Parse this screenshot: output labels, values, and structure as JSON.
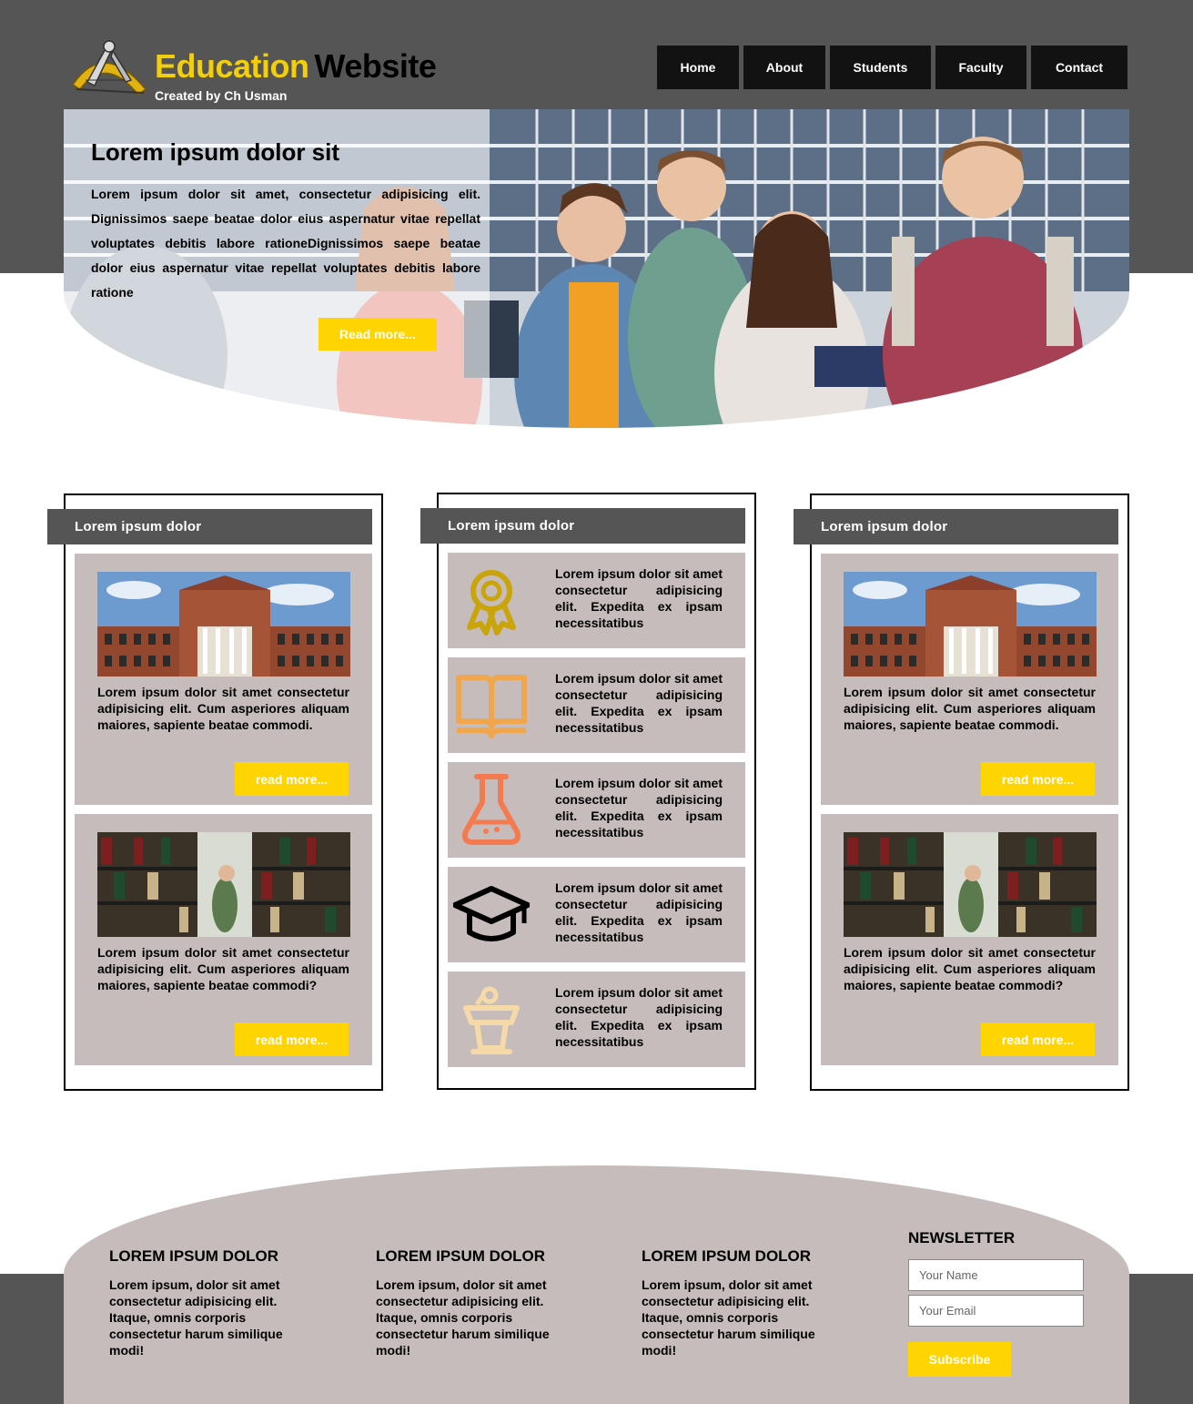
{
  "header": {
    "brand_first": "Education",
    "brand_second": "Website",
    "subtitle": "Created by Ch Usman",
    "nav": [
      "Home",
      "About",
      "Students",
      "Faculty",
      "Contact"
    ]
  },
  "hero": {
    "title": "Lorem ipsum dolor sit",
    "text": "Lorem ipsum dolor sit amet, consectetur adipisicing elit. Dignissimos saepe beatae dolor eius aspernatur vitae repellat voluptates debitis labore rationeDignissimos saepe beatae dolor eius aspernatur vitae repellat voluptates debitis labore ratione",
    "button": "Read more..."
  },
  "columns": {
    "left": {
      "heading": "Lorem ipsum dolor",
      "cards": [
        {
          "image": "university-building-photo",
          "text": "Lorem ipsum dolor sit amet consectetur adipisicing elit. Cum asperiores aliquam maiores, sapiente beatae commodi.",
          "button": "read more..."
        },
        {
          "image": "library-bookshelves-photo",
          "text": "Lorem ipsum dolor sit amet consectetur adipisicing elit. Cum asperiores aliquam maiores, sapiente beatae commodi?",
          "button": "read more..."
        }
      ]
    },
    "middle": {
      "heading": "Lorem ipsum dolor",
      "features": [
        {
          "icon": "award-ribbon-icon",
          "color": "#c9a40a",
          "text": "Lorem ipsum dolor sit amet consectetur adipisicing elit. Expedita ex ipsam necessitatibus"
        },
        {
          "icon": "open-book-icon",
          "color": "#f0a64c",
          "text": "Lorem ipsum dolor sit amet consectetur adipisicing elit. Expedita ex ipsam necessitatibus"
        },
        {
          "icon": "flask-icon",
          "color": "#f47a4f",
          "text": "Lorem ipsum dolor sit amet consectetur adipisicing elit. Expedita ex ipsam necessitatibus"
        },
        {
          "icon": "graduation-cap-icon",
          "color": "#000000",
          "text": "Lorem ipsum dolor sit amet consectetur adipisicing elit. Expedita ex ipsam necessitatibus"
        },
        {
          "icon": "podium-icon",
          "color": "#f6d9a8",
          "text": "Lorem ipsum dolor sit amet consectetur adipisicing elit. Expedita ex ipsam necessitatibus"
        }
      ]
    },
    "right": {
      "heading": "Lorem ipsum dolor",
      "cards": [
        {
          "image": "university-building-photo",
          "text": "Lorem ipsum dolor sit amet consectetur adipisicing elit. Cum asperiores aliquam maiores, sapiente beatae commodi.",
          "button": "read more..."
        },
        {
          "image": "library-bookshelves-photo",
          "text": "Lorem ipsum dolor sit amet consectetur adipisicing elit. Cum asperiores aliquam maiores, sapiente beatae commodi?",
          "button": "read more..."
        }
      ]
    }
  },
  "footer": {
    "columns": [
      {
        "heading": "LOREM IPSUM DOLOR",
        "text": "Lorem ipsum, dolor sit amet consectetur adipisicing elit. Itaque, omnis corporis consectetur harum similique modi!"
      },
      {
        "heading": "LOREM IPSUM DOLOR",
        "text": "Lorem ipsum, dolor sit amet consectetur adipisicing elit. Itaque, omnis corporis consectetur harum similique modi!"
      },
      {
        "heading": "LOREM IPSUM DOLOR",
        "text": "Lorem ipsum, dolor sit amet consectetur adipisicing elit. Itaque, omnis corporis consectetur harum similique modi!"
      }
    ],
    "newsletter": {
      "heading": "NEWSLETTER",
      "name_placeholder": "Your Name",
      "email_placeholder": "Your Email",
      "button": "Subscribe"
    }
  },
  "colors": {
    "dark_band": "#555555",
    "accent_yellow": "#ffd400",
    "card_bg": "#c6bcbb",
    "nav_bg": "#121212"
  }
}
